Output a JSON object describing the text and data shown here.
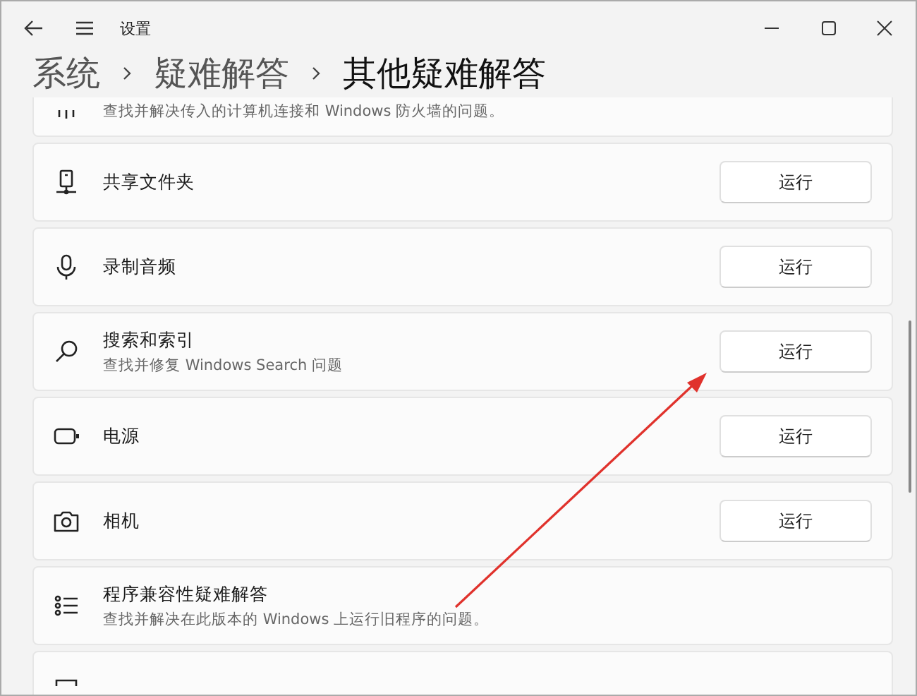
{
  "window": {
    "title": "设置"
  },
  "breadcrumb": [
    {
      "label": "系统",
      "current": false
    },
    {
      "label": "疑难解答",
      "current": false
    },
    {
      "label": "其他疑难解答",
      "current": true
    }
  ],
  "items": [
    {
      "kind": "cut_top",
      "description": "查找并解决传入的计算机连接和 Windows 防火墙的问题。"
    },
    {
      "kind": "full",
      "title": "共享文件夹",
      "button": "运行"
    },
    {
      "kind": "full",
      "title": "录制音频",
      "button": "运行"
    },
    {
      "kind": "full",
      "title": "搜索和索引",
      "description": "查找并修复 Windows Search 问题",
      "button": "运行"
    },
    {
      "kind": "full",
      "title": "电源",
      "button": "运行"
    },
    {
      "kind": "full",
      "title": "相机",
      "button": "运行"
    },
    {
      "kind": "full",
      "title": "程序兼容性疑难解答",
      "description": "查找并解决在此版本的 Windows 上运行旧程序的问题。"
    },
    {
      "kind": "cut_bottom"
    }
  ]
}
